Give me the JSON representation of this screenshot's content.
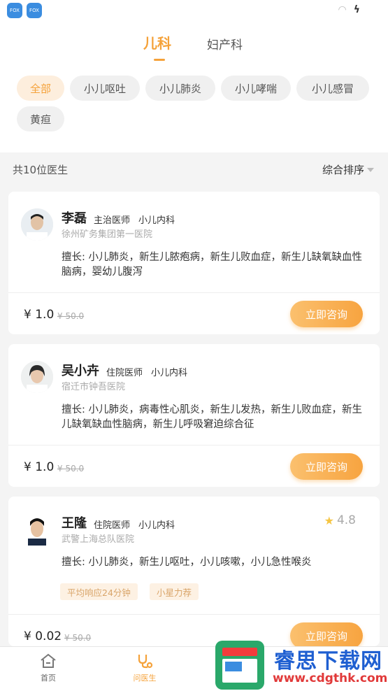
{
  "statusbar": {
    "app_icons": [
      "FOX",
      "FOX"
    ]
  },
  "tabs": [
    "儿科",
    "妇产科"
  ],
  "chips": [
    "全部",
    "小儿呕吐",
    "小儿肺炎",
    "小儿哮喘",
    "小儿感冒",
    "黄疸"
  ],
  "count_text": "共10位医生",
  "sort_label": "综合排序",
  "doctors": [
    {
      "name": "李磊",
      "title": "主治医师",
      "department": "小儿内科",
      "hospital": "徐州矿务集团第一医院",
      "skill": "擅长: 小儿肺炎，新生儿脓疱病，新生儿败血症，新生儿缺氧缺血性脑病，婴幼儿腹泻",
      "price": "¥ 1.0",
      "old_price": "¥ 50.0",
      "button": "立即咨询"
    },
    {
      "name": "吴小卉",
      "title": "住院医师",
      "department": "小儿内科",
      "hospital": "宿迁市钟吾医院",
      "skill": "擅长: 小儿肺炎，病毒性心肌炎，新生儿发热，新生儿败血症，新生儿缺氧缺血性脑病，新生儿呼吸窘迫综合征",
      "price": "¥ 1.0",
      "old_price": "¥ 50.0",
      "button": "立即咨询"
    },
    {
      "name": "王隆",
      "title": "住院医师",
      "department": "小儿内科",
      "hospital": "武警上海总队医院",
      "rating": "4.8",
      "skill": "擅长: 小儿肺炎，新生儿呕吐，小儿咳嗽，小儿急性喉炎",
      "tags": [
        "平均响应24分钟",
        "小星力荐"
      ],
      "price": "¥ 0.02",
      "old_price": "¥ 50.0",
      "button": "立即咨询"
    }
  ],
  "nav": [
    "首页",
    "问医生"
  ],
  "watermark": {
    "title": "睿思下载网",
    "url": "www.cdgthk.com"
  },
  "colors": {
    "accent": "#f5a23a",
    "background": "#f4f4f4"
  }
}
